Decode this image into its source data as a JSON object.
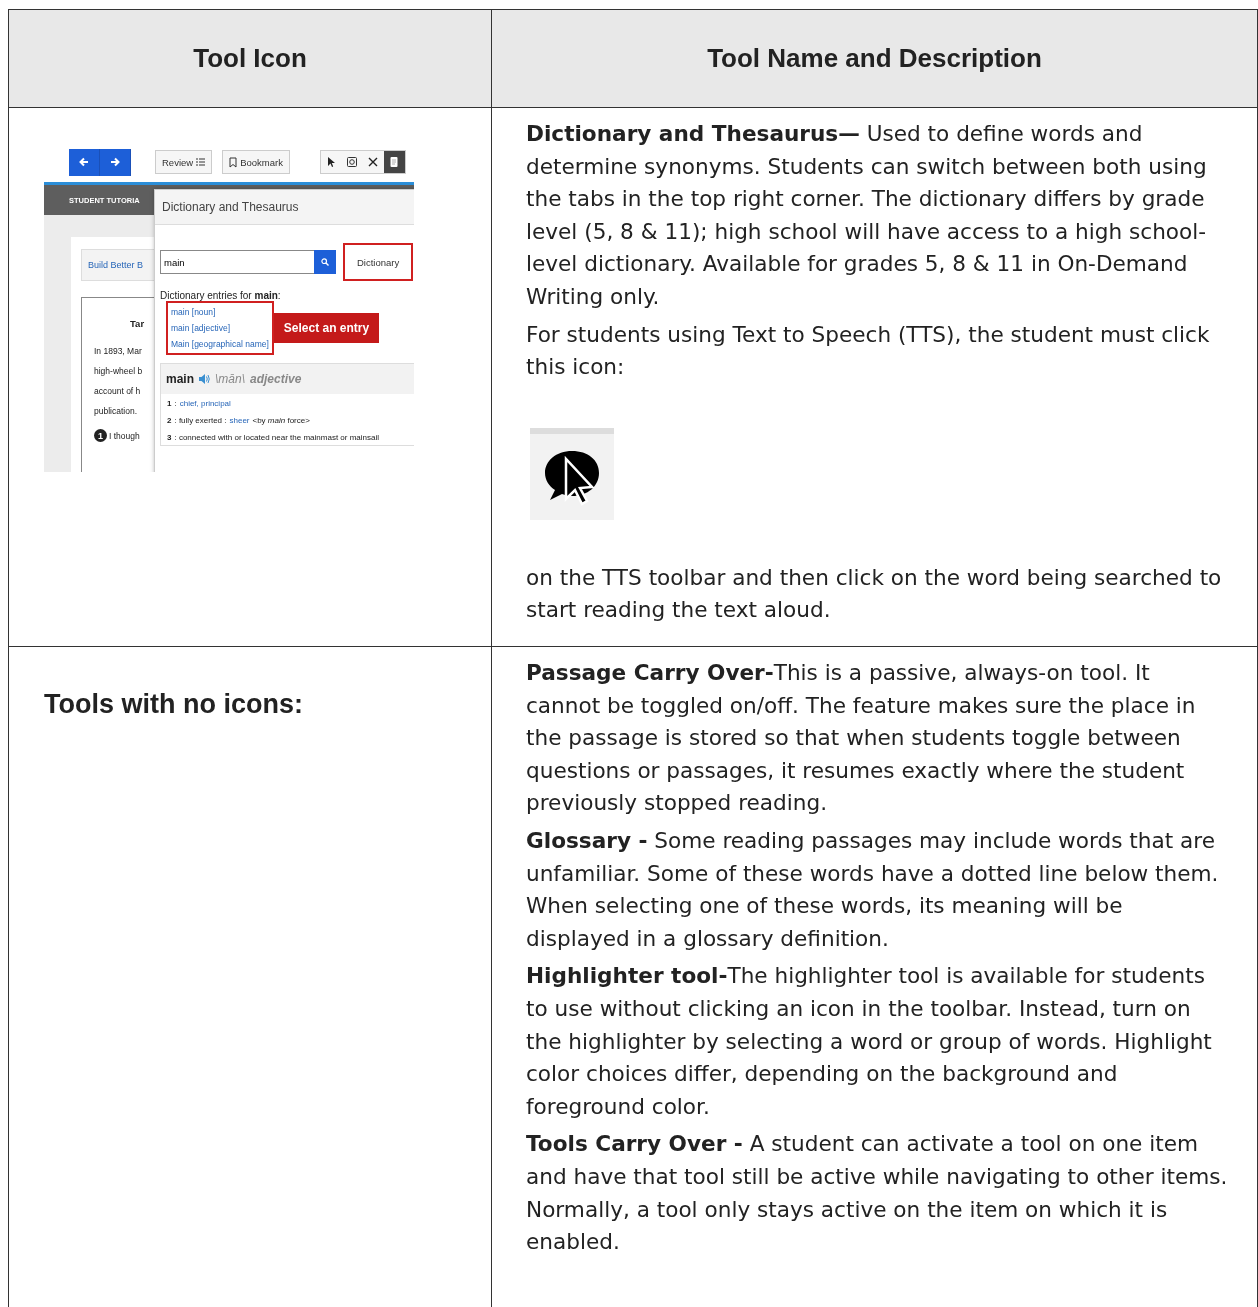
{
  "table": {
    "columns": [
      "Tool Icon",
      "Tool Name and Description"
    ],
    "rows": [
      {
        "icon_cell": {
          "kind": "screenshot",
          "screenshot": {
            "buttons": [
              {
                "label": "Review",
                "kind": "review"
              },
              {
                "label": "Bookmark",
                "kind": "bookmark"
              }
            ],
            "tools": [
              {
                "kind": "pointer",
                "selected": false
              },
              {
                "kind": "mask",
                "selected": false
              },
              {
                "kind": "close",
                "selected": false
              },
              {
                "kind": "notepad",
                "selected": true
              }
            ],
            "banner": "STUDENT TUTORIA",
            "tab": "Build Better B",
            "passage": {
              "title": "Tar",
              "lines": [
                "In 1893, Mar",
                "high-wheel b",
                "account of h",
                "publication."
              ],
              "question": {
                "number": "1",
                "text": "I though"
              }
            },
            "dialog": {
              "title": "Dictionary and Thesaurus",
              "search": {
                "value": "main"
              },
              "tab": {
                "label": "Dictionary",
                "selected": true
              },
              "entries_heading": "Dictionary entries for **main**:",
              "entries": [
                "main [noun]",
                "main [adjective]",
                "Main [geographical name]"
              ],
              "callout": "Select an entry",
              "entry": {
                "word": "main",
                "pronunciation": "\\mān\\",
                "part_of_speech": "adjective",
                "definitions": [
                  {
                    "number": "1",
                    "parts": [
                      {
                        "kind": "plain",
                        "text": ":"
                      },
                      {
                        "kind": "link",
                        "text": "chief, principal"
                      }
                    ]
                  },
                  {
                    "number": "2",
                    "parts": [
                      {
                        "kind": "plain",
                        "text": ": fully exerted :"
                      },
                      {
                        "kind": "link",
                        "text": "sheer"
                      },
                      {
                        "kind": "plain",
                        "text": "<by *main* force>"
                      }
                    ]
                  },
                  {
                    "number": "3",
                    "parts": [
                      {
                        "kind": "plain",
                        "text": ": connected with or located near the mainmast or mainsail"
                      }
                    ]
                  }
                ]
              }
            }
          }
        },
        "description": [
          {
            "kind": "text",
            "text": "**Dictionary and Thesaurus—** Used to define words and determine synonyms. Students can switch between both using the tabs in the top right corner. The dictionary differs by grade level (5, 8 & 11); high school will have access to a high school-level dictionary. Available for grades 5, 8 & 11 in On-Demand Writing only."
          },
          {
            "kind": "text",
            "text": "For students using Text to Speech (TTS), the student must click this icon:"
          },
          {
            "kind": "image"
          },
          {
            "kind": "text",
            "text": "on the TTS toolbar and then click on the word being searched to start reading the text aloud."
          }
        ]
      },
      {
        "icon_cell": {
          "kind": "label",
          "label": "Tools with no icons:"
        },
        "description": [
          {
            "kind": "text",
            "text": "**Passage Carry Over-**This is a passive, always-on tool. It cannot be toggled on/off. The feature makes sure the place in the passage is stored so that when students toggle between questions or passages, it resumes exactly where the student previously stopped reading."
          },
          {
            "kind": "text",
            "text": "**Glossary -** Some reading passages may include words that are unfamiliar. Some of these words have a dotted line below them. When selecting one of these words, its meaning will be displayed in a glossary definition."
          },
          {
            "kind": "text",
            "text": "**Highlighter tool-**The highlighter tool is available for students to use without clicking an icon in the toolbar. Instead, turn on the highlighter by selecting a word or group of words. Highlight color choices differ, depending on the background and foreground color."
          },
          {
            "kind": "text",
            "text": "**Tools Carry Over -** A student can activate a tool on one item and have that tool still be active while navigating to other items. Normally, a tool only stays active on the item on which it is enabled."
          }
        ]
      }
    ]
  }
}
